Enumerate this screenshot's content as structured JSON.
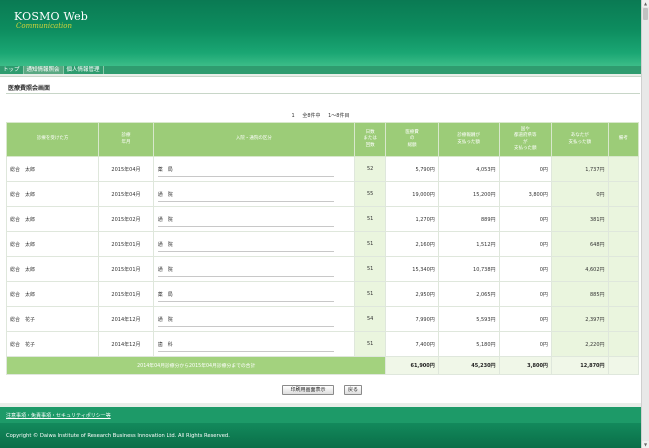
{
  "header": {
    "logo": "KOSMO Web",
    "logo_sub": "Communication"
  },
  "nav": {
    "tabs": [
      "トップ",
      "通知情報照会",
      "個人情報管理"
    ]
  },
  "main": {
    "title": "医療費照会画面",
    "pager": {
      "page": "1",
      "summary": "全8件中",
      "range": "1～8件目"
    }
  },
  "table": {
    "headers": [
      "診療を受けた方",
      "診療\n年月",
      "入院・通院の区分",
      "日数\nまたは\n回数",
      "医療費\nの\n総額",
      "診療報酬が\n支払った額",
      "国や\n都道府県等\nが\n支払った額",
      "あなたが\n支払った額",
      "備考"
    ],
    "rows": [
      {
        "name": "総合　太郎",
        "month": "2015年04月",
        "kind": "薬　局",
        "days": "52",
        "total": "5,790円",
        "insurer": "4,053円",
        "public": "0円",
        "self": "1,737円"
      },
      {
        "name": "総合　太郎",
        "month": "2015年04月",
        "kind": "通　院",
        "days": "55",
        "total": "19,000円",
        "insurer": "15,200円",
        "public": "3,800円",
        "self": "0円"
      },
      {
        "name": "総合　太郎",
        "month": "2015年02月",
        "kind": "通　院",
        "days": "51",
        "total": "1,270円",
        "insurer": "889円",
        "public": "0円",
        "self": "381円"
      },
      {
        "name": "総合　太郎",
        "month": "2015年01月",
        "kind": "通　院",
        "days": "51",
        "total": "2,160円",
        "insurer": "1,512円",
        "public": "0円",
        "self": "648円"
      },
      {
        "name": "総合　太郎",
        "month": "2015年01月",
        "kind": "通　院",
        "days": "51",
        "total": "15,340円",
        "insurer": "10,738円",
        "public": "0円",
        "self": "4,602円"
      },
      {
        "name": "総合　太郎",
        "month": "2015年01月",
        "kind": "薬　局",
        "days": "51",
        "total": "2,950円",
        "insurer": "2,065円",
        "public": "0円",
        "self": "885円"
      },
      {
        "name": "総合　花子",
        "month": "2014年12月",
        "kind": "通　院",
        "days": "54",
        "total": "7,990円",
        "insurer": "5,593円",
        "public": "0円",
        "self": "2,397円"
      },
      {
        "name": "総合　花子",
        "month": "2014年12月",
        "kind": "歯　科",
        "days": "51",
        "total": "7,400円",
        "insurer": "5,180円",
        "public": "0円",
        "self": "2,220円"
      }
    ],
    "total": {
      "label": "2014年04月診療分から2015年04月診療分までの合計",
      "total": "61,900円",
      "insurer": "45,230円",
      "public": "3,800円",
      "self": "12,870円"
    }
  },
  "buttons": {
    "print": "印刷用画面表示",
    "back": "戻る"
  },
  "footer": {
    "links": "注意事項・免責事項・セキュリティポリシー等",
    "copyright": "Copyright © Daiwa Institute of Research Business Innovation Ltd. All Rights Reserved."
  }
}
